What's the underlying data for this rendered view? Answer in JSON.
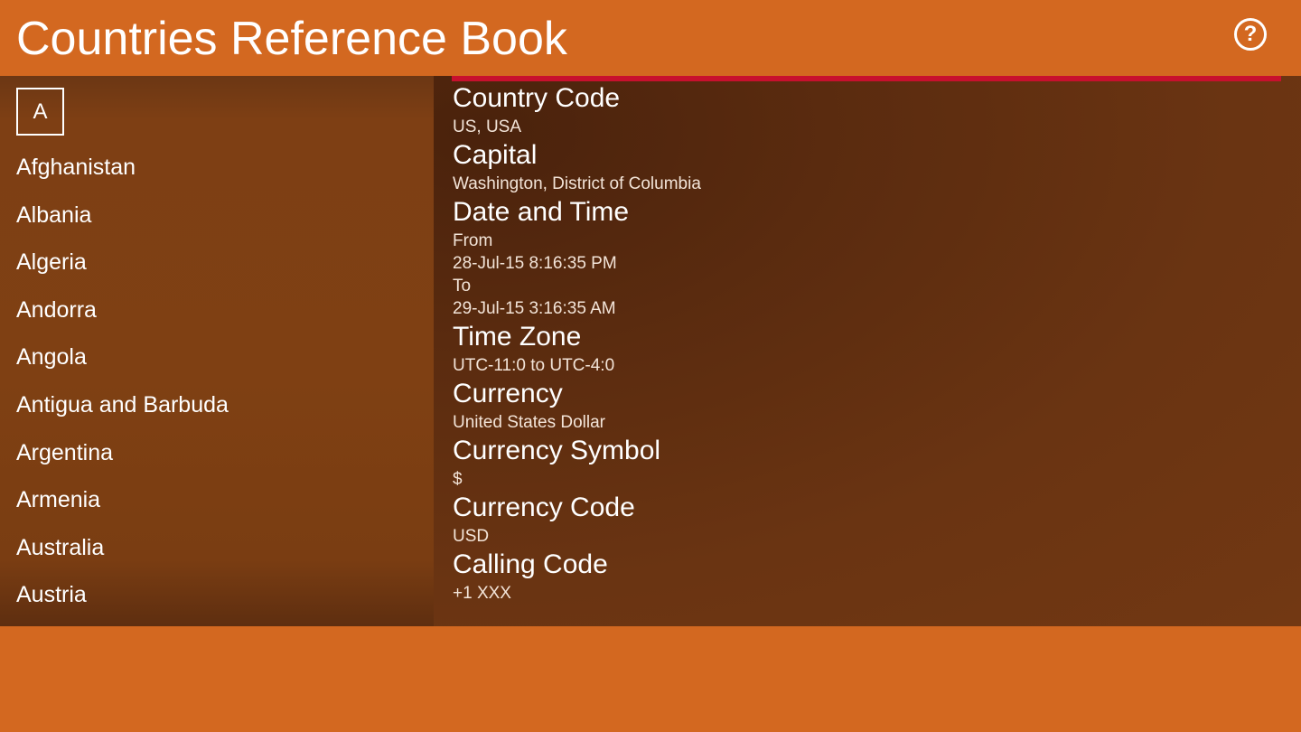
{
  "app": {
    "title": "Countries Reference Book",
    "help_glyph": "?",
    "accent_color": "#d36820",
    "highlight_color": "#c8102e"
  },
  "sidebar": {
    "letter": "A",
    "countries": [
      "Afghanistan",
      "Albania",
      "Algeria",
      "Andorra",
      "Angola",
      "Antigua and Barbuda",
      "Argentina",
      "Armenia",
      "Australia",
      "Austria"
    ]
  },
  "details": {
    "country_code": {
      "label": "Country Code",
      "value": "US, USA"
    },
    "capital": {
      "label": "Capital",
      "value": "Washington, District of Columbia"
    },
    "date_time": {
      "label": "Date and Time",
      "from_label": "From",
      "from_value": "28-Jul-15 8:16:35 PM",
      "to_label": "To",
      "to_value": "29-Jul-15 3:16:35 AM"
    },
    "time_zone": {
      "label": "Time Zone",
      "value": "UTC-11:0 to UTC-4:0"
    },
    "currency": {
      "label": "Currency",
      "value": "United States Dollar"
    },
    "currency_symbol": {
      "label": "Currency Symbol",
      "value": "$"
    },
    "currency_code": {
      "label": "Currency Code",
      "value": "USD"
    },
    "calling_code": {
      "label": "Calling Code",
      "value": "+1 XXX"
    }
  }
}
